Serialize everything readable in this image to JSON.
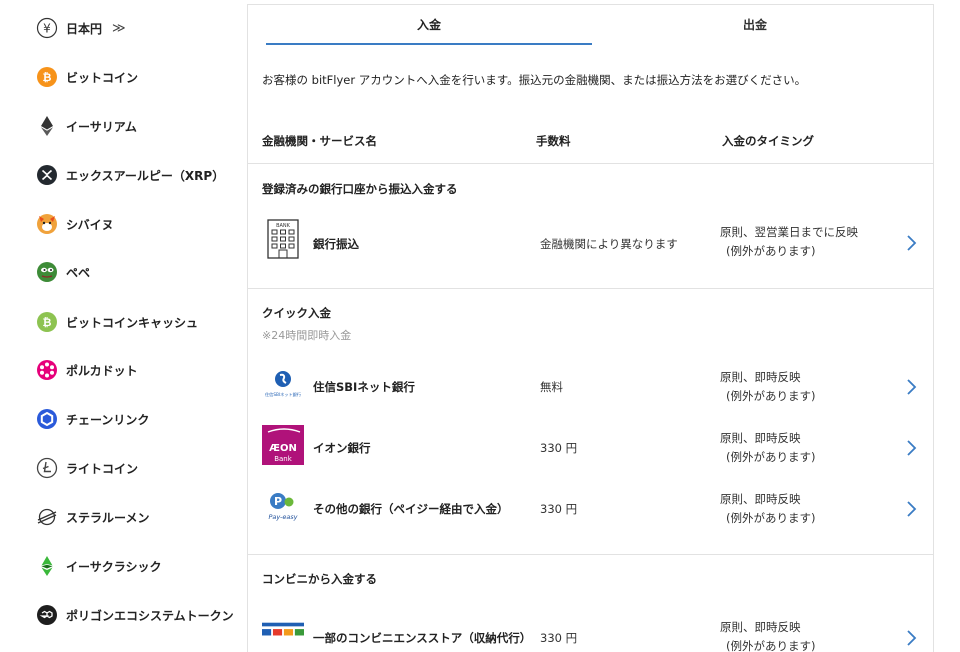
{
  "sidebar": {
    "items": [
      {
        "label": "日本円",
        "icon": "yen-icon",
        "expand": "≫"
      },
      {
        "label": "ビットコイン",
        "icon": "bitcoin-icon"
      },
      {
        "label": "イーサリアム",
        "icon": "ethereum-icon"
      },
      {
        "label": "エックスアールピー（XRP）",
        "icon": "xrp-icon"
      },
      {
        "label": "シバイヌ",
        "icon": "shiba-inu-icon"
      },
      {
        "label": "ペペ",
        "icon": "pepe-icon"
      },
      {
        "label": "ビットコインキャッシュ",
        "icon": "bitcoin-cash-icon"
      },
      {
        "label": "ポルカドット",
        "icon": "polkadot-icon"
      },
      {
        "label": "チェーンリンク",
        "icon": "chainlink-icon"
      },
      {
        "label": "ライトコイン",
        "icon": "litecoin-icon"
      },
      {
        "label": "ステラルーメン",
        "icon": "stellar-icon"
      },
      {
        "label": "イーサクラシック",
        "icon": "ethereum-classic-icon"
      },
      {
        "label": "ポリゴンエコシステムトークン",
        "icon": "polygon-icon"
      }
    ]
  },
  "tabs": {
    "deposit": "入金",
    "withdraw": "出金"
  },
  "intro": "お客様の bitFlyer アカウントへ入金を行います。振込元の金融機関、または振込方法をお選びください。",
  "columns": {
    "name": "金融機関・サービス名",
    "fee": "手数料",
    "timing": "入金のタイミング"
  },
  "sections": {
    "bank": {
      "title": "登録済みの銀行口座から振込入金する",
      "rows": [
        {
          "name": "銀行振込",
          "fee": "金融機関により異なります",
          "timing1": "原則、翌営業日までに反映",
          "timing2": "(例外があります)",
          "logo_text": "BANK"
        }
      ]
    },
    "quick": {
      "title": "クイック入金",
      "subtitle": "※24時間即時入金",
      "rows": [
        {
          "name": "住信SBIネット銀行",
          "fee": "無料",
          "timing1": "原則、即時反映",
          "timing2": "(例外があります)",
          "logo_text": "住信SBIネット銀行"
        },
        {
          "name": "イオン銀行",
          "fee": "330 円",
          "timing1": "原則、即時反映",
          "timing2": "(例外があります)",
          "logo_text1": "ÆON",
          "logo_text2": "Bank"
        },
        {
          "name": "その他の銀行（ペイジー経由で入金）",
          "fee": "330 円",
          "timing1": "原則、即時反映",
          "timing2": "(例外があります)",
          "logo_text": "Pay-easy"
        }
      ]
    },
    "convenience": {
      "title": "コンビニから入金する",
      "rows": [
        {
          "name": "一部のコンビニエンスストア（収納代行）",
          "fee": "330 円",
          "timing1": "原則、即時反映",
          "timing2": "(例外があります)"
        }
      ]
    }
  },
  "colors": {
    "accent": "#3a7cc4",
    "bitcoin": "#f7931a",
    "shib": "#e94e1b",
    "pepe": "#3d8b37",
    "bch": "#8dc351",
    "polkadot": "#e6007a",
    "chainlink": "#2a5ada",
    "etc": "#3ab83a",
    "aeon": "#b0127a"
  }
}
